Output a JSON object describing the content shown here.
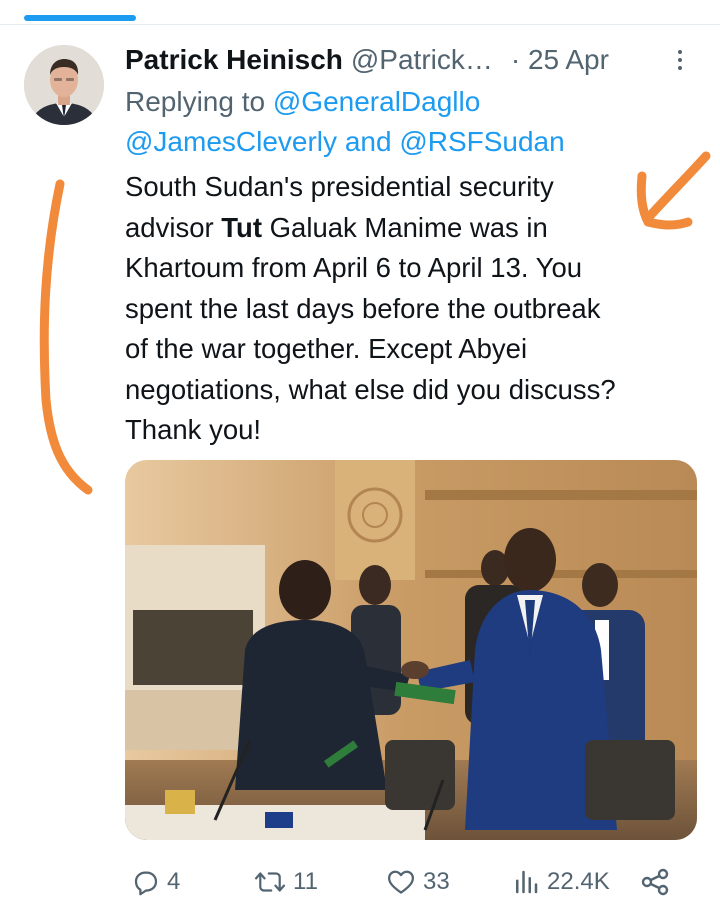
{
  "tweet": {
    "author_name": "Patrick Heinisch",
    "author_handle": "@Patrick…",
    "time": "· 25 Apr",
    "replying_to_prefix": "Replying to",
    "mention_1": "@GeneralDagllo",
    "mention_2": "@JamesCleverly",
    "mention_joiner": "and",
    "mention_3": "@RSFSudan",
    "text_line_1": "South Sudan's presidential security",
    "text_line_2_pre": "advisor ",
    "text_line_2_bold": "Tut",
    "text_line_2_post": " Galuak Manime was in",
    "text_line_3": "Khartoum from April 6 to April 13. You",
    "text_line_4": "spent the last days before the outbreak",
    "text_line_5": "of the war together. Except Abyei",
    "text_line_6": "negotiations, what else did you discuss?",
    "text_line_7": "Thank you!"
  },
  "stats": {
    "replies": "4",
    "reposts": "11",
    "likes": "33",
    "views": "22.4K"
  },
  "colors": {
    "accent": "#1d9bf0",
    "secondary_text": "#536471",
    "annotation": "#f28a3b"
  },
  "icons": [
    "more-vertical-icon",
    "reply-icon",
    "repost-icon",
    "like-icon",
    "views-icon",
    "share-icon"
  ]
}
